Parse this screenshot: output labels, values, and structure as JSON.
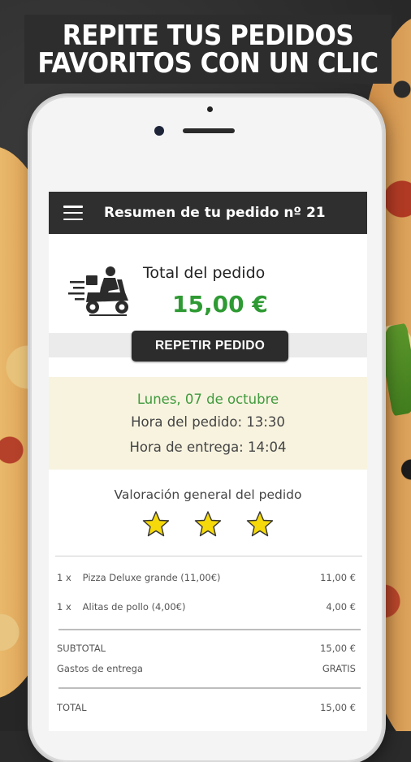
{
  "headline": [
    "REPITE TUS PEDIDOS",
    "FAVORITOS CON UN CLIC"
  ],
  "appbar": {
    "title": "Resumen de tu pedido nº 21"
  },
  "order": {
    "total_label": "Total del pedido",
    "total_amount": "15,00 €",
    "repeat_button": "REPETIR PEDIDO",
    "date": "Lunes, 07 de octubre",
    "order_time": "Hora del pedido: 13:30",
    "delivery_time": "Hora de entrega: 14:04"
  },
  "rating": {
    "title": "Valoración general del pedido",
    "stars": 3
  },
  "items": [
    {
      "qty": "1 x",
      "name": "Pizza Deluxe grande (11,00€)",
      "price": "11,00 €"
    },
    {
      "qty": "1 x",
      "name": "Alitas de pollo (4,00€)",
      "price": "4,00 €"
    }
  ],
  "summary": {
    "subtotal_label": "SUBTOTAL",
    "subtotal_value": "15,00 €",
    "delivery_label": "Gastos de entrega",
    "delivery_value": "GRATIS",
    "total_label": "TOTAL",
    "total_value": "15,00 €"
  },
  "colors": {
    "accent_green": "#2e9a33",
    "appbar": "#2f2f2f",
    "star": "#f5d90a"
  },
  "icons": {
    "menu": "hamburger-icon",
    "delivery": "scooter-icon",
    "rating": "star-icon"
  }
}
